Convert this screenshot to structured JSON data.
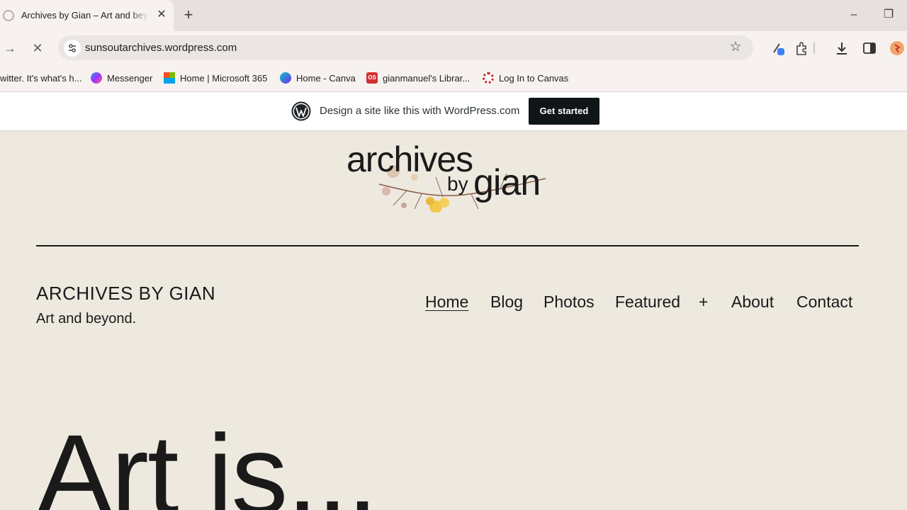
{
  "browser": {
    "tab_title": "Archives by Gian – Art and beyond",
    "url": "sunsoutarchives.wordpress.com"
  },
  "bookmarks": [
    {
      "label": "witter. It's what's h...",
      "icon": "twitter-icon"
    },
    {
      "label": "Messenger",
      "icon": "messenger-icon",
      "color": "#a033ff"
    },
    {
      "label": "Home | Microsoft 365",
      "icon": "microsoft-icon"
    },
    {
      "label": "Home - Canva",
      "icon": "canva-icon",
      "color": "#7d2ae8"
    },
    {
      "label": "gianmanuel's Librar...",
      "icon": "os-icon",
      "color": "#d32f2f"
    },
    {
      "label": "Log In to Canvas",
      "icon": "canvas-icon",
      "color": "#c62828"
    }
  ],
  "wp_banner": {
    "text": "Design a site like this with WordPress.com",
    "button": "Get started"
  },
  "site": {
    "logo_words": [
      "archives",
      "by",
      "gian"
    ],
    "title": "ARCHIVES BY GIAN",
    "tagline": "Art and beyond.",
    "nav": [
      {
        "label": "Home",
        "current": true
      },
      {
        "label": "Blog"
      },
      {
        "label": "Photos"
      },
      {
        "label": "Featured"
      },
      {
        "label": "+"
      },
      {
        "label": "About"
      },
      {
        "label": "Contact"
      }
    ],
    "hero_heading": "Art is..."
  },
  "colors": {
    "page_bg": "#ede9df",
    "text": "#1a1a1a",
    "chrome_bg": "#f7f2f0",
    "wp_button": "#101517"
  }
}
